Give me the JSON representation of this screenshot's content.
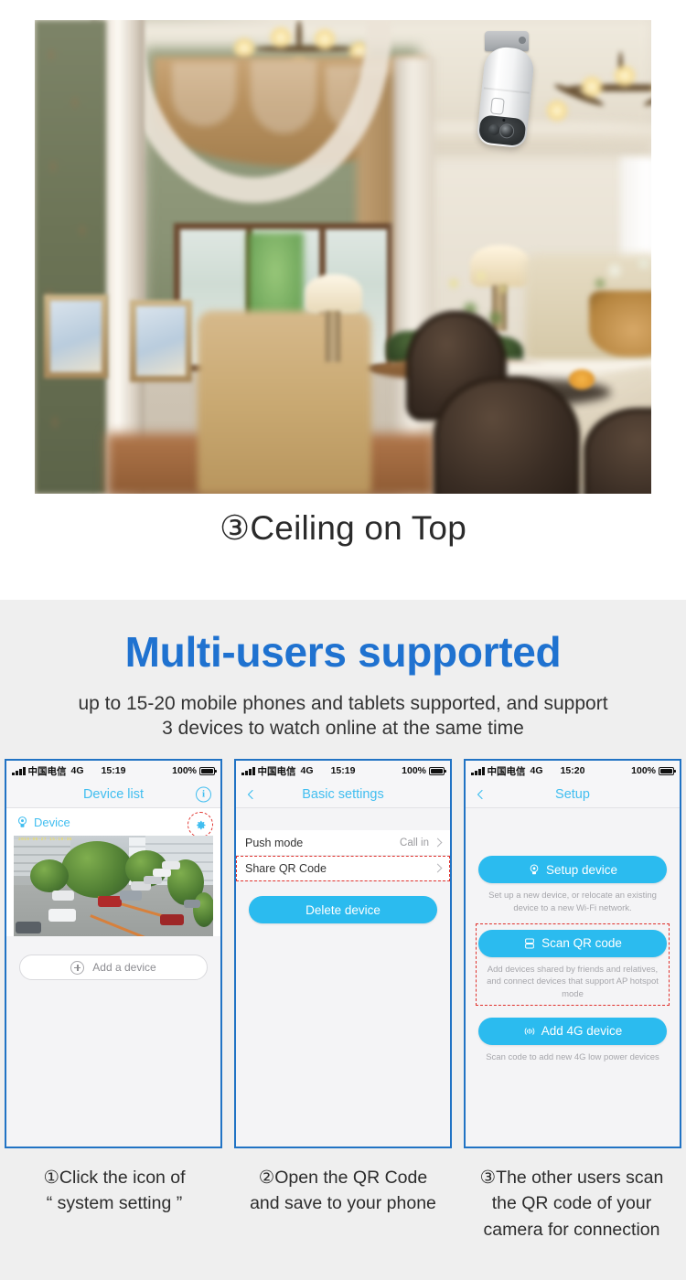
{
  "hero": {
    "caption": "③Ceiling on Top",
    "scene_alt": "ceiling-mounted-camera-in-living-room"
  },
  "promo": {
    "headline": "Multi-users supported",
    "subhead_line1": "up to 15-20 mobile phones and tablets supported, and support",
    "subhead_line2": "3 devices to watch online at the same time"
  },
  "colors": {
    "headline_blue": "#1f72d0",
    "app_cyan": "#2bbbef",
    "nav_cyan": "#41bef0",
    "highlight_red": "#e0312c",
    "section_grey": "#efefef"
  },
  "phones": [
    {
      "id": "device-list",
      "status": {
        "carrier": "中国电信",
        "network": "4G",
        "time": "15:19",
        "battery": "100%"
      },
      "nav": {
        "title": "Device list",
        "info_label": "i"
      },
      "device": {
        "name": "Device",
        "camera_icon": "camera-icon",
        "gear_icon": "gear-icon"
      },
      "add_device_label": "Add a device",
      "cctv_timestamp": "2019-06-27 15:19:38"
    },
    {
      "id": "basic-settings",
      "status": {
        "carrier": "中国电信",
        "network": "4G",
        "time": "15:19",
        "battery": "100%"
      },
      "nav": {
        "title": "Basic settings",
        "back_icon": "chevron-left-icon"
      },
      "rows": [
        {
          "label": "Push mode",
          "value": "Call in",
          "highlighted": false
        },
        {
          "label": "Share QR Code",
          "value": "",
          "highlighted": true
        }
      ],
      "delete_button": "Delete device"
    },
    {
      "id": "setup",
      "status": {
        "carrier": "中国电信",
        "network": "4G",
        "time": "15:20",
        "battery": "100%"
      },
      "nav": {
        "title": "Setup",
        "back_icon": "chevron-left-icon"
      },
      "actions": [
        {
          "label": "Setup device",
          "icon": "camera-target-icon",
          "hint": "Set up a new device, or relocate an existing device to a new Wi-Fi network.",
          "highlighted": false
        },
        {
          "label": "Scan QR code",
          "icon": "qr-scan-icon",
          "hint": "Add devices shared by friends and relatives, and connect devices that support AP hotspot mode",
          "highlighted": true
        },
        {
          "label": "Add 4G device",
          "icon": "signal-wave-icon",
          "hint": "Scan code to add new 4G low power devices",
          "highlighted": false
        }
      ]
    }
  ],
  "captions": [
    {
      "line1": "①Click the icon of",
      "line2": "“ system setting ”",
      "line3": ""
    },
    {
      "line1": "②Open the QR Code",
      "line2": "and save to your phone",
      "line3": ""
    },
    {
      "line1": "③The other users scan",
      "line2": "the QR code of your",
      "line3": "camera for connection"
    }
  ]
}
